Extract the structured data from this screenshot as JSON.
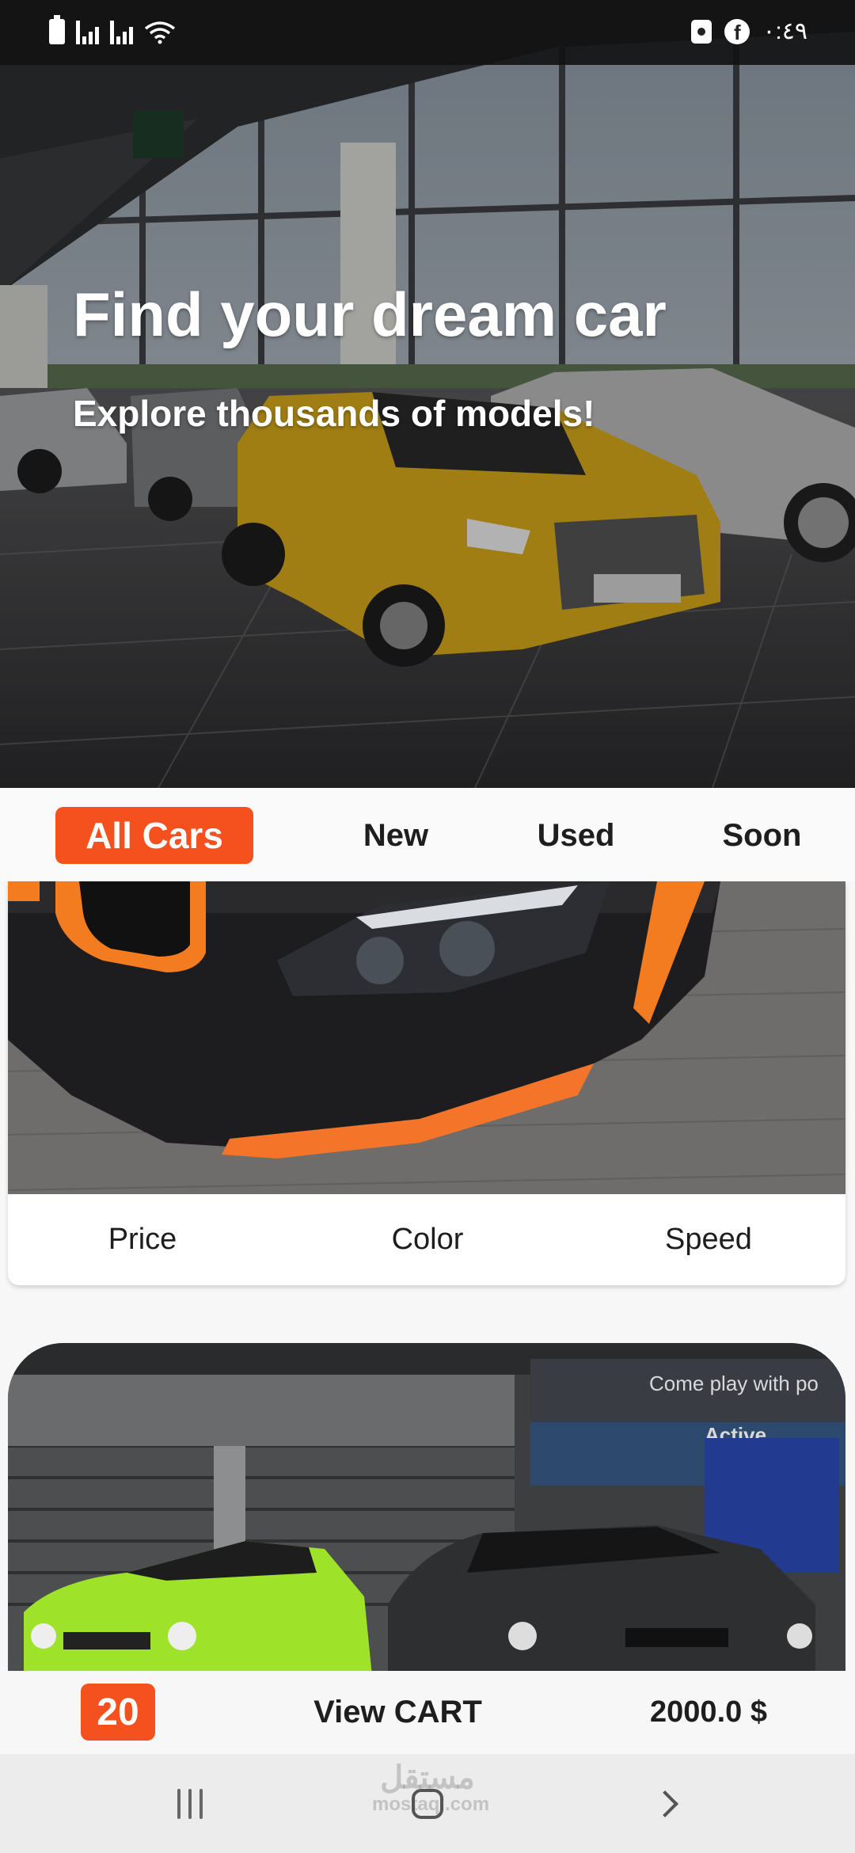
{
  "status_bar": {
    "time": "٠:٤٩",
    "icons": [
      "battery-icon",
      "signal-icon",
      "signal-icon",
      "wifi-icon",
      "screen-record-icon",
      "facebook-icon"
    ]
  },
  "hero": {
    "title": "Find your dream car",
    "subtitle": "Explore thousands of models!"
  },
  "tabs": [
    {
      "label": "All Cars",
      "active": true
    },
    {
      "label": "New",
      "active": false
    },
    {
      "label": "Used",
      "active": false
    },
    {
      "label": "Soon",
      "active": false
    }
  ],
  "cards": [
    {
      "image": "black-orange-car-front-photo",
      "features": [
        "Price",
        "Color",
        "Speed"
      ]
    },
    {
      "image": "garage-green-and-black-cars-photo",
      "sign_text": "Come play with po",
      "sign_text_2": "Active"
    }
  ],
  "cart": {
    "count": "20",
    "view_label": "View CART",
    "total": "2000.0 $"
  },
  "nav": {
    "icons": [
      "recents-icon",
      "home-icon",
      "back-icon"
    ],
    "watermark_ar": "مستقل",
    "watermark_en": "mostaql.com"
  },
  "colors": {
    "accent": "#f4511e",
    "text": "#1e1e1e",
    "background": "#f7f7f7"
  }
}
